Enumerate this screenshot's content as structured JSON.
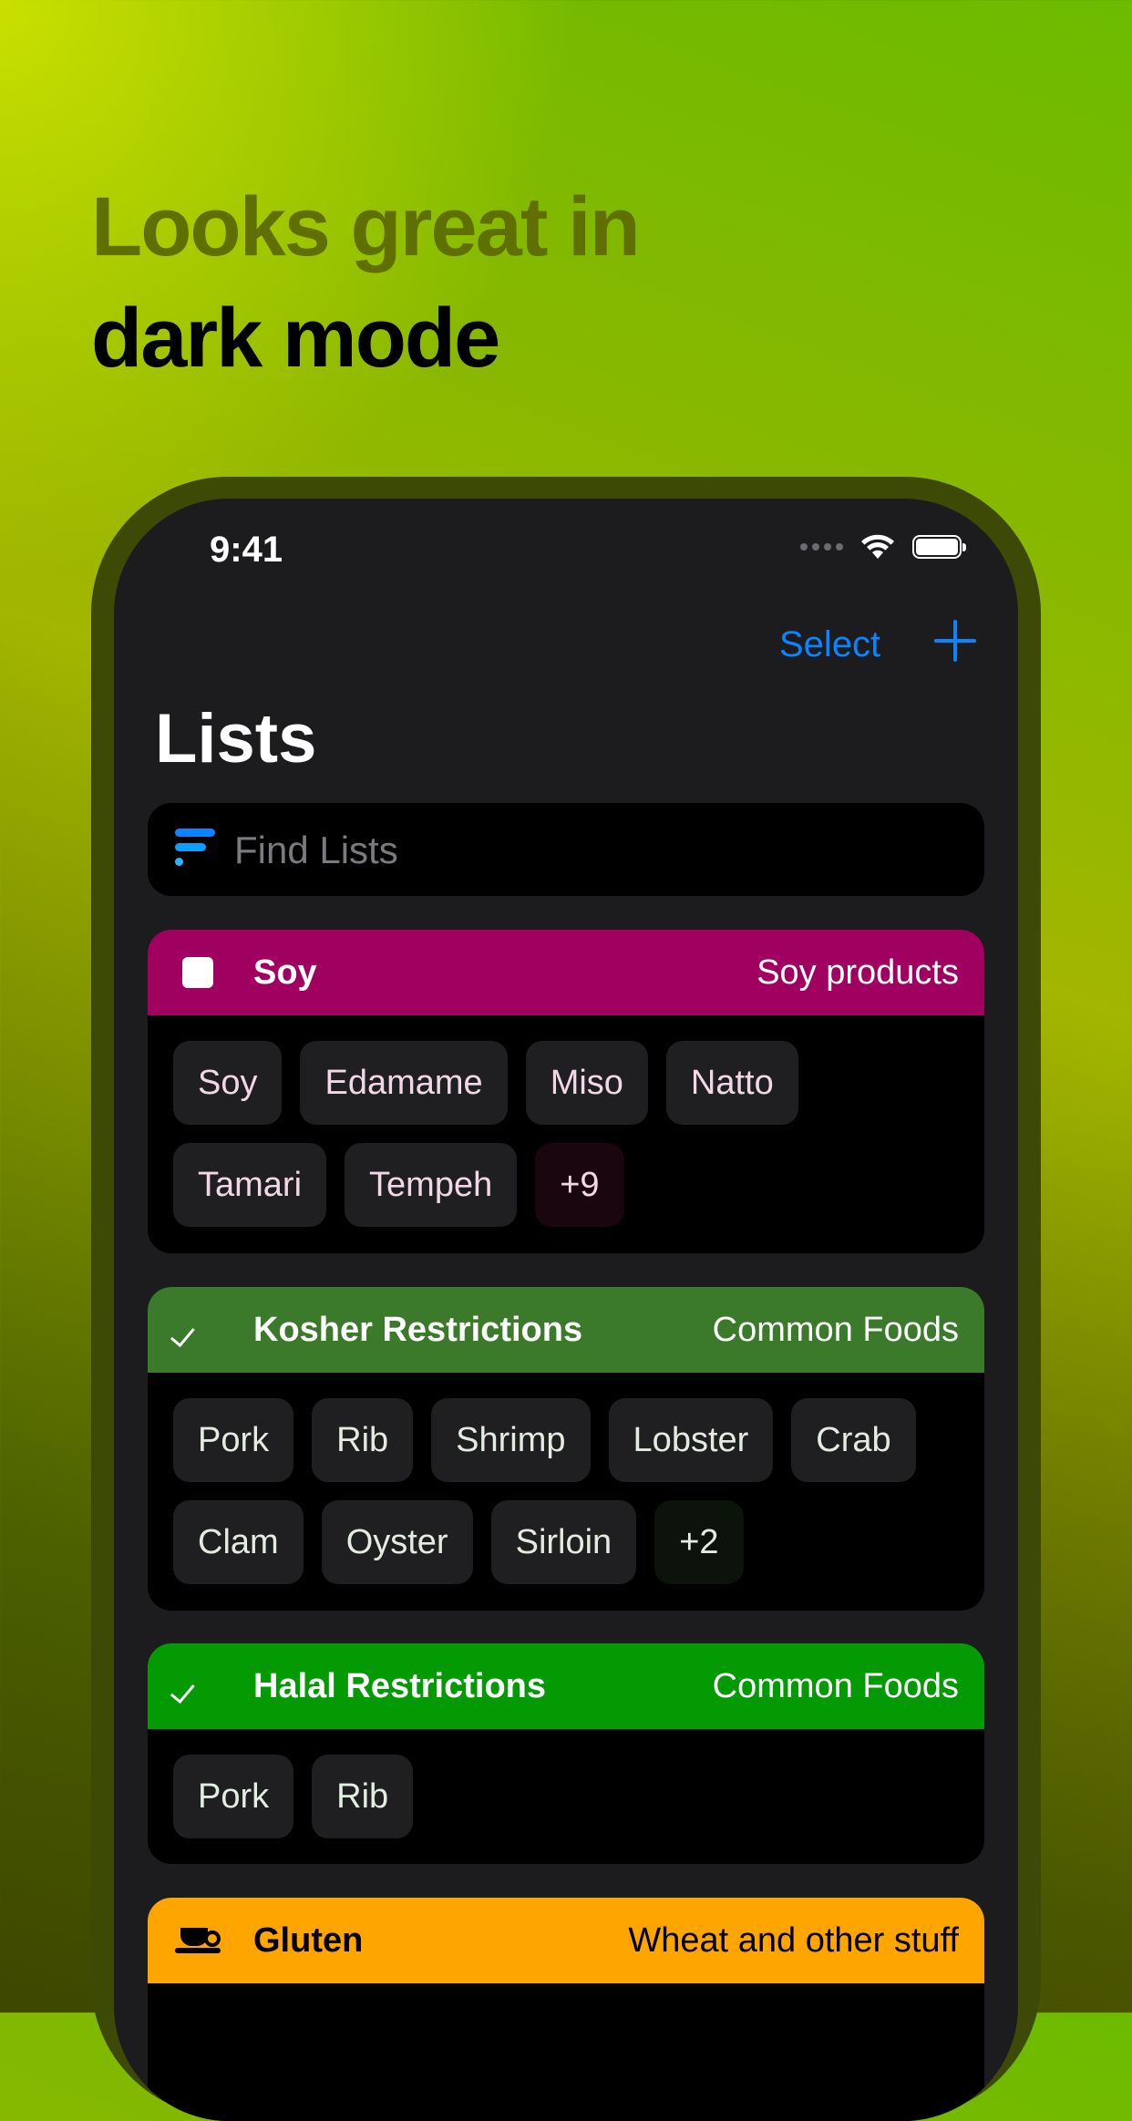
{
  "headline": {
    "line1": "Looks great in",
    "line2": "dark mode"
  },
  "status": {
    "time": "9:41"
  },
  "nav": {
    "select_label": "Select",
    "title": "Lists"
  },
  "search": {
    "placeholder": "Find Lists"
  },
  "lists": [
    {
      "icon": "checkbox-square-icon",
      "title": "Soy",
      "subtitle": "Soy products",
      "color": "#a0005f",
      "chip_bg": "#1f1f21",
      "chip_text": "#f2d8e6",
      "more_bg": "#1a060f",
      "items": [
        "Soy",
        "Edamame",
        "Miso",
        "Natto",
        "Tamari",
        "Tempeh"
      ],
      "more": "+9"
    },
    {
      "icon": "checkmark-icon",
      "title": "Kosher Restrictions",
      "subtitle": "Common Foods",
      "color": "#3b7a2b",
      "chip_bg": "#1f1f21",
      "chip_text": "#e4ece2",
      "more_bg": "#0b130a",
      "items": [
        "Pork",
        "Rib",
        "Shrimp",
        "Lobster",
        "Crab",
        "Clam",
        "Oyster",
        "Sirloin"
      ],
      "more": "+2"
    },
    {
      "icon": "checkmark-icon",
      "title": "Halal Restrictions",
      "subtitle": "Common Foods",
      "color": "#049a04",
      "chip_bg": "#1f1f21",
      "chip_text": "#e2eee2",
      "more_bg": "#071407",
      "items": [
        "Pork",
        "Rib"
      ],
      "more": ""
    },
    {
      "icon": "cup-icon",
      "title": "Gluten",
      "subtitle": "Wheat and other stuff",
      "color": "#ffa500",
      "title_color": "#000000",
      "chip_bg": "#1f1f21",
      "chip_text": "#ffffff",
      "more_bg": "#1f1f21",
      "items": [],
      "more": ""
    }
  ]
}
